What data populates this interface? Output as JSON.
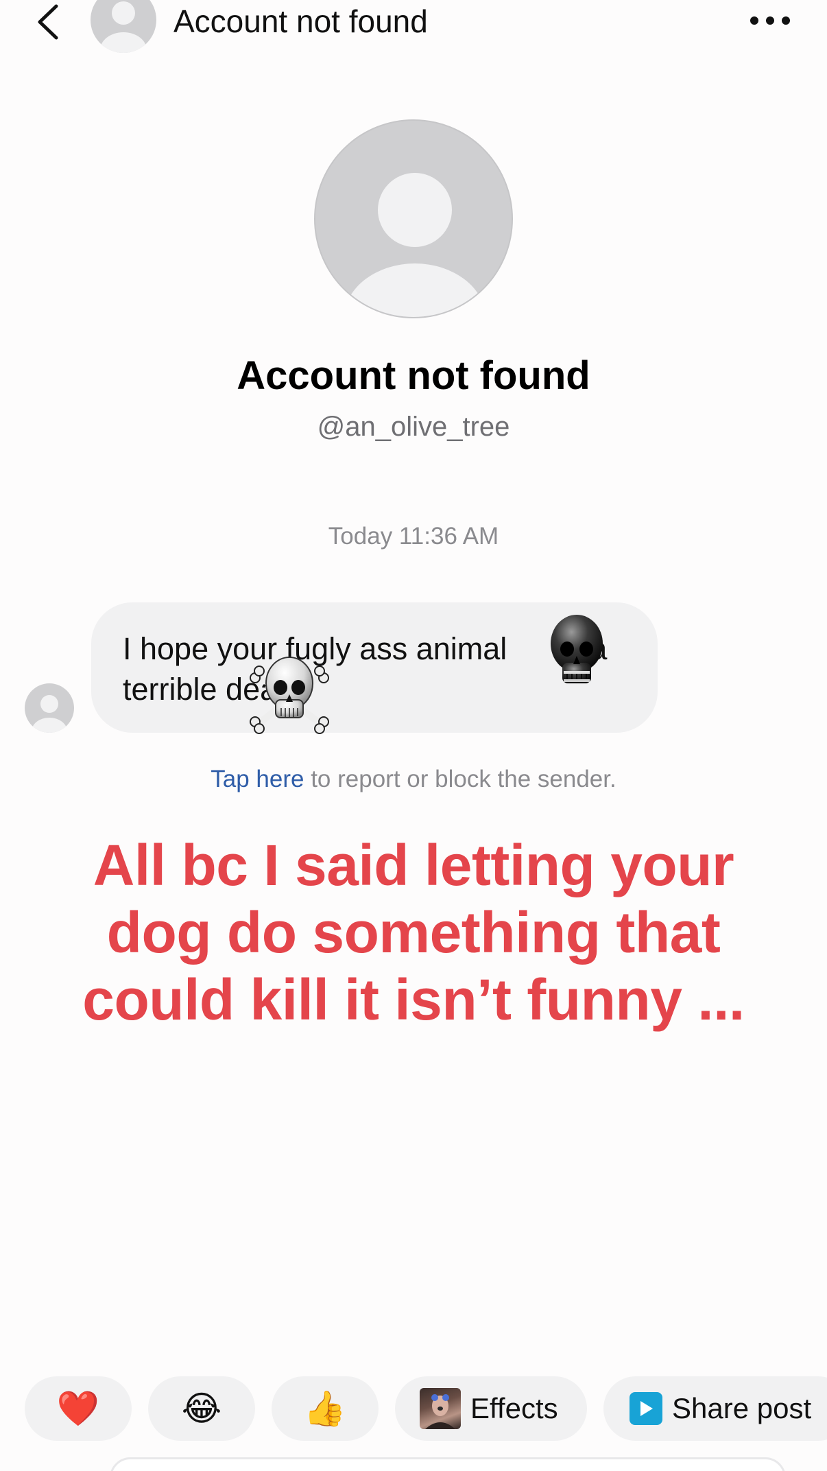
{
  "header": {
    "title": "Account not found",
    "back_icon": "chevron-left-icon",
    "more_icon": "ellipsis-icon"
  },
  "profile": {
    "name": "Account not found",
    "handle": "@an_olive_tree"
  },
  "thread": {
    "timestamp": "Today 11:36 AM",
    "message": {
      "line1": "I hope your fugly ass animal",
      "line1_tail": "a",
      "line2": "terrible death"
    },
    "report": {
      "link": "Tap here",
      "text": " to report or block the sender."
    }
  },
  "caption": {
    "line1": "All bc I said letting your",
    "line2": "dog do something that",
    "line3": "could kill it isn’t funny ..."
  },
  "quick_actions": {
    "heart": "❤️",
    "laugh": "😂",
    "thumb": "👍",
    "effects_label": "Effects",
    "share_label": "Share post"
  },
  "colors": {
    "caption": "#e4454b",
    "link": "#2f5da8",
    "share_icon": "#18a3d6"
  }
}
